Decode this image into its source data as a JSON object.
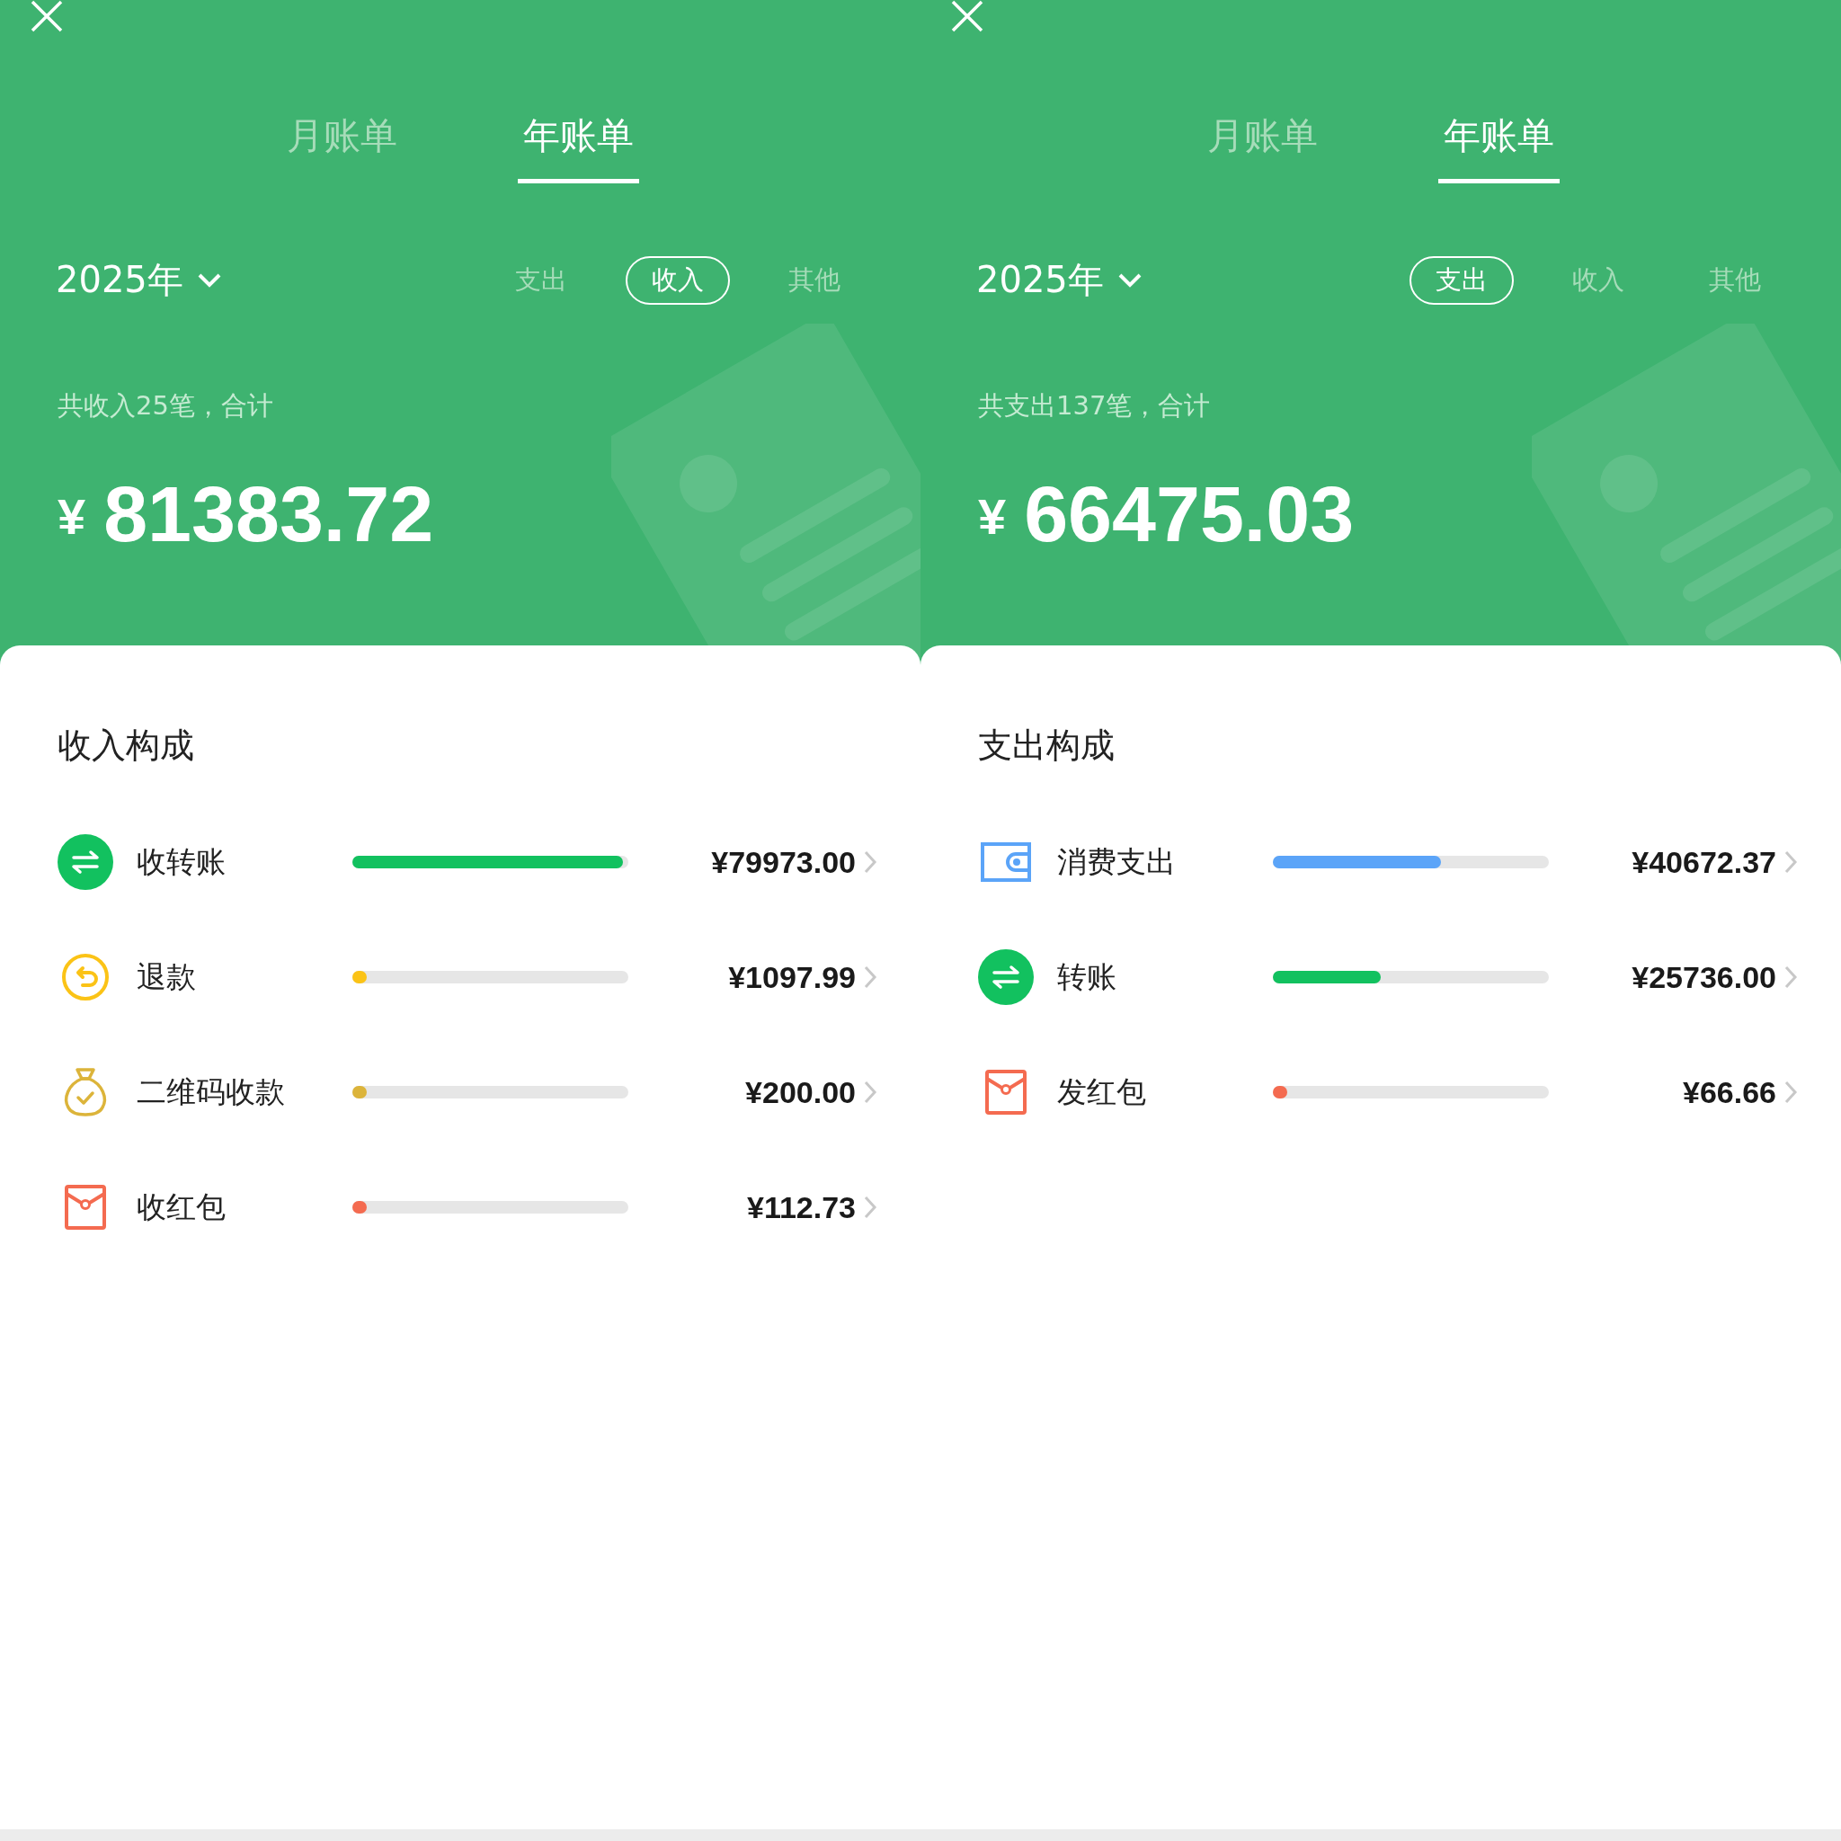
{
  "panels": [
    {
      "tabs": [
        {
          "label": "月账单",
          "selected": false
        },
        {
          "label": "年账单",
          "selected": true
        }
      ],
      "year": "2025年",
      "filters": [
        {
          "label": "支出",
          "selected": false
        },
        {
          "label": "收入",
          "selected": true
        },
        {
          "label": "其他",
          "selected": false
        }
      ],
      "summary": "共收入25笔，合计",
      "currency": "¥",
      "total": "81383.72",
      "section_title": "收入构成",
      "items": [
        {
          "kind": "transfer",
          "label": "收转账",
          "level": 0.98,
          "color": "#12c15f",
          "amount": "¥79973.00"
        },
        {
          "kind": "refund",
          "label": "退款",
          "level": 0.01,
          "color": "#fbc316",
          "amount": "¥1097.99"
        },
        {
          "kind": "moneybag",
          "label": "二维码收款",
          "level": 0.01,
          "color": "#dcb43a",
          "amount": "¥200.00"
        },
        {
          "kind": "redpacket",
          "label": "收红包",
          "level": 0.01,
          "color": "#f46b50",
          "amount": "¥112.73"
        }
      ]
    },
    {
      "tabs": [
        {
          "label": "月账单",
          "selected": false
        },
        {
          "label": "年账单",
          "selected": true
        }
      ],
      "year": "2025年",
      "filters": [
        {
          "label": "支出",
          "selected": true
        },
        {
          "label": "收入",
          "selected": false
        },
        {
          "label": "其他",
          "selected": false
        }
      ],
      "summary": "共支出137笔，合计",
      "currency": "¥",
      "total": "66475.03",
      "section_title": "支出构成",
      "items": [
        {
          "kind": "wallet",
          "label": "消费支出",
          "level": 0.61,
          "color": "#5ba4f8",
          "amount": "¥40672.37"
        },
        {
          "kind": "transfer",
          "label": "转账",
          "level": 0.39,
          "color": "#12c15f",
          "amount": "¥25736.00"
        },
        {
          "kind": "redpacket",
          "label": "发红包",
          "level": 0.01,
          "color": "#f46b50",
          "amount": "¥66.66"
        }
      ]
    }
  ]
}
